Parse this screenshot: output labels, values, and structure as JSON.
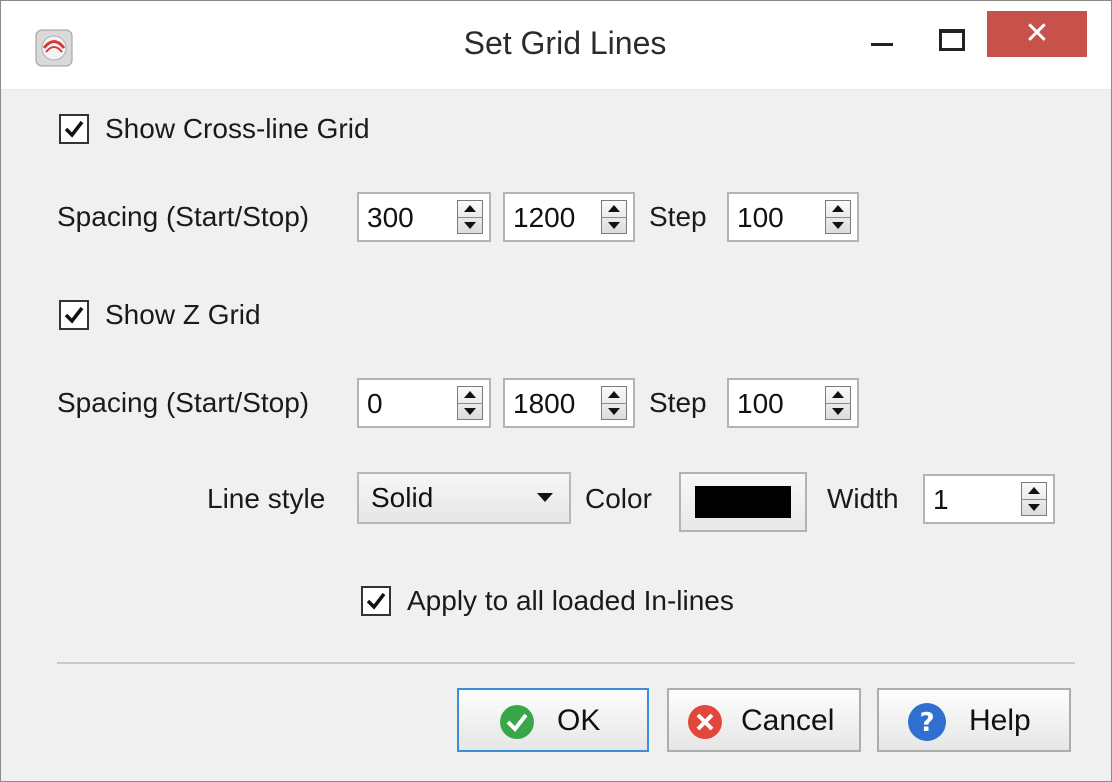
{
  "window": {
    "title": "Set Grid Lines",
    "close_symbol": "✕"
  },
  "crossline": {
    "show_label": "Show Cross-line Grid",
    "show_checked": true,
    "spacing_label": "Spacing (Start/Stop)",
    "start": "300",
    "stop": "1200",
    "step_label": "Step",
    "step": "100"
  },
  "zgrid": {
    "show_label": "Show Z Grid",
    "show_checked": true,
    "spacing_label": "Spacing (Start/Stop)",
    "start": "0",
    "stop": "1800",
    "step_label": "Step",
    "step": "100"
  },
  "style": {
    "line_style_label": "Line style",
    "line_style_value": "Solid",
    "color_label": "Color",
    "color_value": "#000000",
    "width_label": "Width",
    "width_value": "1"
  },
  "apply": {
    "label": "Apply to all loaded In-lines",
    "checked": true
  },
  "buttons": {
    "ok": "OK",
    "cancel": "Cancel",
    "help": "Help"
  },
  "colors": {
    "close_red": "#c7514b",
    "ok_green": "#3aa64a",
    "cancel_red": "#e2473c",
    "help_blue": "#2f6fd0",
    "default_border": "#3c8fd6"
  },
  "icons": {
    "app": "app-logo-icon",
    "ok": "ok-check-icon",
    "cancel": "cancel-x-icon",
    "help": "help-question-icon"
  }
}
